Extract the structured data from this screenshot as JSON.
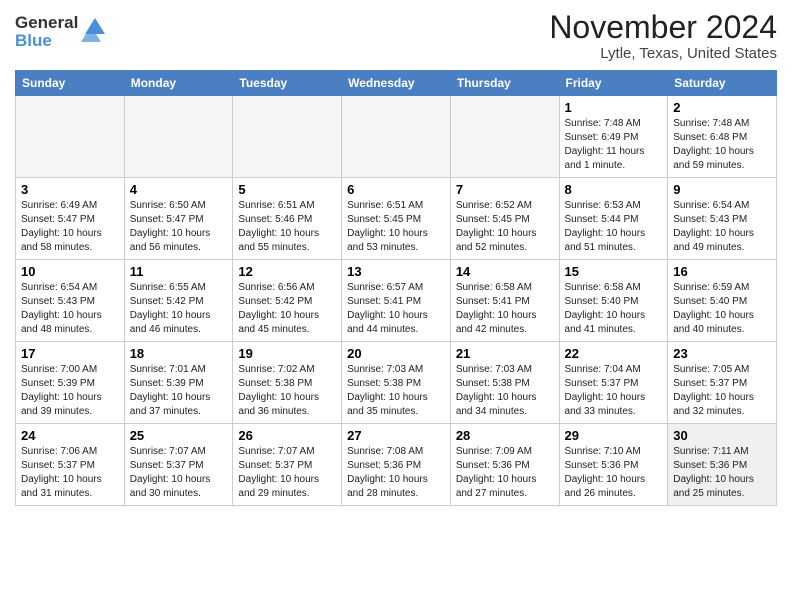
{
  "logo": {
    "general": "General",
    "blue": "Blue"
  },
  "title": "November 2024",
  "location": "Lytle, Texas, United States",
  "weekdays": [
    "Sunday",
    "Monday",
    "Tuesday",
    "Wednesday",
    "Thursday",
    "Friday",
    "Saturday"
  ],
  "weeks": [
    [
      {
        "day": "",
        "info": "",
        "empty": true
      },
      {
        "day": "",
        "info": "",
        "empty": true
      },
      {
        "day": "",
        "info": "",
        "empty": true
      },
      {
        "day": "",
        "info": "",
        "empty": true
      },
      {
        "day": "",
        "info": "",
        "empty": true
      },
      {
        "day": "1",
        "info": "Sunrise: 7:48 AM\nSunset: 6:49 PM\nDaylight: 11 hours\nand 1 minute."
      },
      {
        "day": "2",
        "info": "Sunrise: 7:48 AM\nSunset: 6:48 PM\nDaylight: 10 hours\nand 59 minutes."
      }
    ],
    [
      {
        "day": "3",
        "info": "Sunrise: 6:49 AM\nSunset: 5:47 PM\nDaylight: 10 hours\nand 58 minutes."
      },
      {
        "day": "4",
        "info": "Sunrise: 6:50 AM\nSunset: 5:47 PM\nDaylight: 10 hours\nand 56 minutes."
      },
      {
        "day": "5",
        "info": "Sunrise: 6:51 AM\nSunset: 5:46 PM\nDaylight: 10 hours\nand 55 minutes."
      },
      {
        "day": "6",
        "info": "Sunrise: 6:51 AM\nSunset: 5:45 PM\nDaylight: 10 hours\nand 53 minutes."
      },
      {
        "day": "7",
        "info": "Sunrise: 6:52 AM\nSunset: 5:45 PM\nDaylight: 10 hours\nand 52 minutes."
      },
      {
        "day": "8",
        "info": "Sunrise: 6:53 AM\nSunset: 5:44 PM\nDaylight: 10 hours\nand 51 minutes."
      },
      {
        "day": "9",
        "info": "Sunrise: 6:54 AM\nSunset: 5:43 PM\nDaylight: 10 hours\nand 49 minutes."
      }
    ],
    [
      {
        "day": "10",
        "info": "Sunrise: 6:54 AM\nSunset: 5:43 PM\nDaylight: 10 hours\nand 48 minutes."
      },
      {
        "day": "11",
        "info": "Sunrise: 6:55 AM\nSunset: 5:42 PM\nDaylight: 10 hours\nand 46 minutes."
      },
      {
        "day": "12",
        "info": "Sunrise: 6:56 AM\nSunset: 5:42 PM\nDaylight: 10 hours\nand 45 minutes."
      },
      {
        "day": "13",
        "info": "Sunrise: 6:57 AM\nSunset: 5:41 PM\nDaylight: 10 hours\nand 44 minutes."
      },
      {
        "day": "14",
        "info": "Sunrise: 6:58 AM\nSunset: 5:41 PM\nDaylight: 10 hours\nand 42 minutes."
      },
      {
        "day": "15",
        "info": "Sunrise: 6:58 AM\nSunset: 5:40 PM\nDaylight: 10 hours\nand 41 minutes."
      },
      {
        "day": "16",
        "info": "Sunrise: 6:59 AM\nSunset: 5:40 PM\nDaylight: 10 hours\nand 40 minutes."
      }
    ],
    [
      {
        "day": "17",
        "info": "Sunrise: 7:00 AM\nSunset: 5:39 PM\nDaylight: 10 hours\nand 39 minutes."
      },
      {
        "day": "18",
        "info": "Sunrise: 7:01 AM\nSunset: 5:39 PM\nDaylight: 10 hours\nand 37 minutes."
      },
      {
        "day": "19",
        "info": "Sunrise: 7:02 AM\nSunset: 5:38 PM\nDaylight: 10 hours\nand 36 minutes."
      },
      {
        "day": "20",
        "info": "Sunrise: 7:03 AM\nSunset: 5:38 PM\nDaylight: 10 hours\nand 35 minutes."
      },
      {
        "day": "21",
        "info": "Sunrise: 7:03 AM\nSunset: 5:38 PM\nDaylight: 10 hours\nand 34 minutes."
      },
      {
        "day": "22",
        "info": "Sunrise: 7:04 AM\nSunset: 5:37 PM\nDaylight: 10 hours\nand 33 minutes."
      },
      {
        "day": "23",
        "info": "Sunrise: 7:05 AM\nSunset: 5:37 PM\nDaylight: 10 hours\nand 32 minutes."
      }
    ],
    [
      {
        "day": "24",
        "info": "Sunrise: 7:06 AM\nSunset: 5:37 PM\nDaylight: 10 hours\nand 31 minutes."
      },
      {
        "day": "25",
        "info": "Sunrise: 7:07 AM\nSunset: 5:37 PM\nDaylight: 10 hours\nand 30 minutes."
      },
      {
        "day": "26",
        "info": "Sunrise: 7:07 AM\nSunset: 5:37 PM\nDaylight: 10 hours\nand 29 minutes."
      },
      {
        "day": "27",
        "info": "Sunrise: 7:08 AM\nSunset: 5:36 PM\nDaylight: 10 hours\nand 28 minutes."
      },
      {
        "day": "28",
        "info": "Sunrise: 7:09 AM\nSunset: 5:36 PM\nDaylight: 10 hours\nand 27 minutes."
      },
      {
        "day": "29",
        "info": "Sunrise: 7:10 AM\nSunset: 5:36 PM\nDaylight: 10 hours\nand 26 minutes."
      },
      {
        "day": "30",
        "info": "Sunrise: 7:11 AM\nSunset: 5:36 PM\nDaylight: 10 hours\nand 25 minutes.",
        "shaded": true
      }
    ]
  ]
}
